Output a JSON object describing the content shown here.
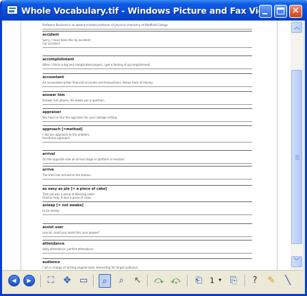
{
  "window": {
    "title": "Whole Vocabulary.tif - Windows Picture and Fax Vie...",
    "min_label": "minimize",
    "max_label": "maximize",
    "close_glyph": "✕"
  },
  "document": {
    "top_line": "Professor Brainerd is an absent-minded professor of physical chemistry at Medfield College.",
    "entries": [
      {
        "head": "accident",
        "ex": "Sorry, I have done this by accident.",
        "ex2": "Car accident"
      },
      {
        "head": "accomplishment",
        "ex": "When I finish a big and complicated project, I get a feeling of accomplishment.",
        "ex2": ""
      },
      {
        "head": "accountant",
        "ex": "An accountant writes financial accounts and transactions. Keeps track of money.",
        "ex2": ""
      },
      {
        "head": "answer him",
        "ex": "Answer him please. He asked you a question.",
        "ex2": ""
      },
      {
        "head": "appraiser",
        "ex": "You have to hire the appraiser for your cottage selling.",
        "ex2": ""
      },
      {
        "head": "approach [=method]",
        "ex": "I like her approach to the problem.",
        "ex2": "functional approach"
      },
      {
        "head": "arrival",
        "ex": "On the opposite side an arrival stage or platform is erected.",
        "ex2": ""
      },
      {
        "head": "arrive",
        "ex": "The train has arrived to the station.",
        "ex2": ""
      },
      {
        "head": "as easy as pie [= a piece of cake]",
        "ex": "That job was a piece of blessing cake!",
        "ex2": "Glad to help. It was a piece of cake."
      },
      {
        "head": "asleep [= not awake]",
        "ex": "to be asleep",
        "ex2": ""
      },
      {
        "head": "assist user",
        "ex": "Leonid, could you assist this user please?",
        "ex2": ""
      },
      {
        "head": "attendance",
        "ex": "daily attendance; perfect attendance",
        "ex2": ""
      },
      {
        "head": "audience",
        "ex": "I am in charge of writing original texts interesting for target audience.",
        "ex2": ""
      }
    ]
  },
  "toolbar": {
    "prev_icon": "previous-image-icon",
    "next_icon": "next-image-icon",
    "page_number": "1",
    "page_dropdown_arrow": "▾"
  }
}
